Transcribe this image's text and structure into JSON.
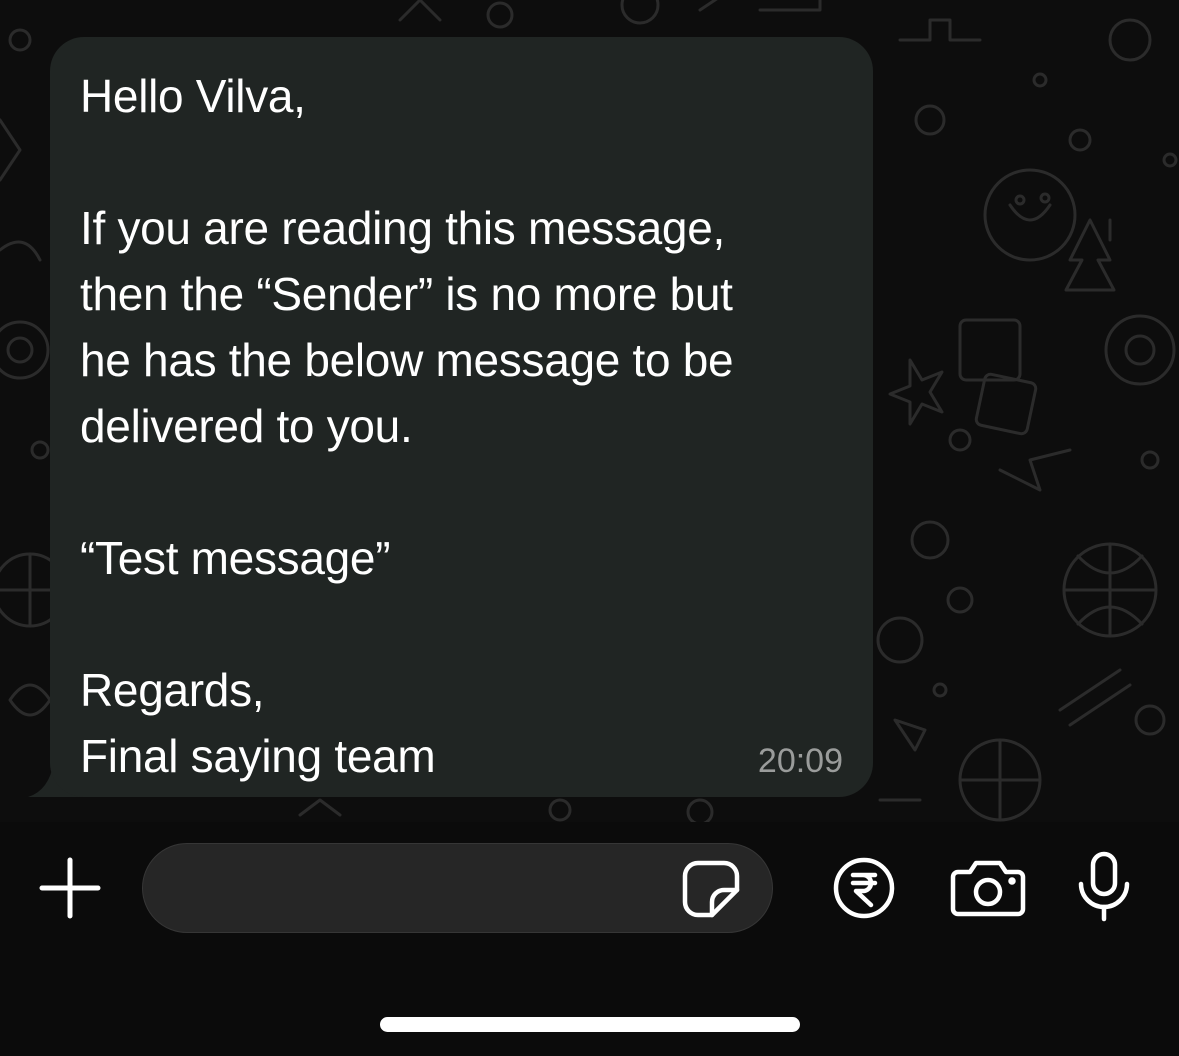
{
  "message": {
    "text": "Hello Vilva,\n\nIf you are reading this message,\nthen the “Sender” is no more but\nhe has the below message to be\ndelivered to you.\n\n“Test message”\n\nRegards,\nFinal saying team",
    "time": "20:09"
  },
  "composer": {
    "input_value": "",
    "input_placeholder": ""
  },
  "icons": {
    "attach": "plus-icon",
    "sticker": "sticker-icon",
    "payment": "rupee-icon",
    "camera": "camera-icon",
    "voice": "microphone-icon"
  },
  "colors": {
    "bubble": "#202523",
    "background": "#0d0d0d",
    "bottom_bar": "#0b0b0b",
    "timestamp": "#9a9c9b"
  }
}
